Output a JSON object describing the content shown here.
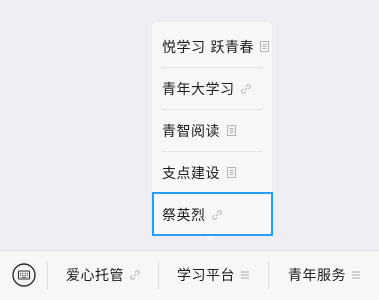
{
  "menu": {
    "items": [
      {
        "label": "悦学习 跃青春",
        "icon": "page-icon"
      },
      {
        "label": "青年大学习",
        "icon": "link-icon"
      },
      {
        "label": "青智阅读",
        "icon": "page-icon"
      },
      {
        "label": "支点建设",
        "icon": "page-icon"
      },
      {
        "label": "祭英烈",
        "icon": "link-icon"
      }
    ],
    "highlight_color": "#2a9df4"
  },
  "bottom_bar": {
    "keyboard_icon": "keyboard-icon",
    "tabs": [
      {
        "label": "爱心托管",
        "icon": "link-icon"
      },
      {
        "label": "学习平台",
        "icon": "menu-icon"
      },
      {
        "label": "青年服务",
        "icon": "menu-icon"
      }
    ]
  }
}
